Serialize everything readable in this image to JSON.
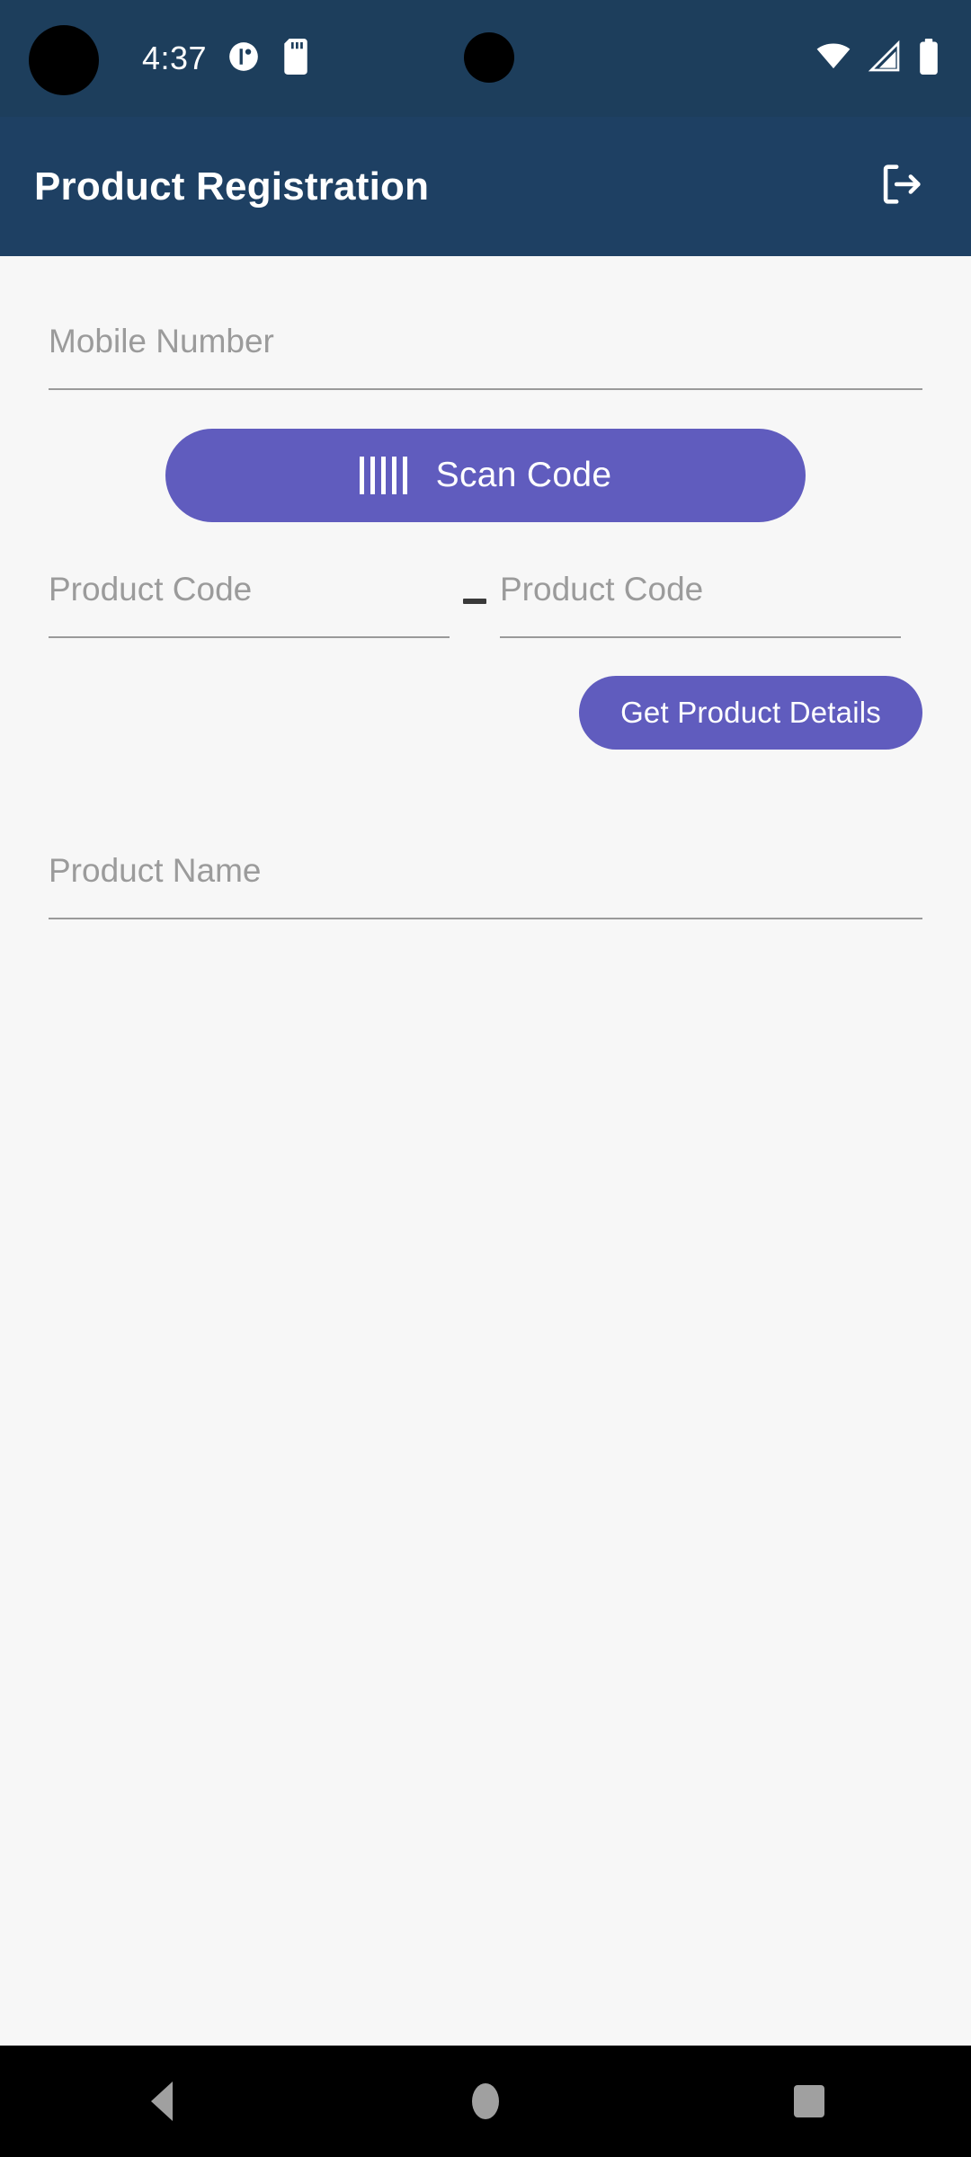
{
  "status_bar": {
    "time": "4:37",
    "background_color": "#1D3E5C",
    "notification_icons": [
      "app-circle-icon",
      "sd-card-icon"
    ],
    "system_icons": [
      "wifi-icon",
      "cellular-signal-icon",
      "battery-icon"
    ]
  },
  "app_bar": {
    "title": "Product Registration",
    "background_color": "#1E4063",
    "action_icon": "logout-icon"
  },
  "form": {
    "mobile_number": {
      "placeholder": "Mobile Number",
      "value": ""
    },
    "scan_button": {
      "label": "Scan Code",
      "icon": "barcode-icon",
      "color": "#605CBE"
    },
    "product_code_first": {
      "placeholder": "Product Code",
      "value": ""
    },
    "separator": "—",
    "product_code_second": {
      "placeholder": "Product Code",
      "value": ""
    },
    "get_details_button": {
      "label": "Get Product Details",
      "color": "#605CBE"
    },
    "product_name": {
      "placeholder": "Product Name",
      "value": ""
    }
  },
  "nav_bar": {
    "background_color": "#000000",
    "buttons": [
      {
        "name": "back",
        "icon": "back-triangle-icon"
      },
      {
        "name": "home",
        "icon": "home-circle-icon"
      },
      {
        "name": "recents",
        "icon": "recents-square-icon"
      }
    ]
  },
  "theme": {
    "content_background": "#F7F7F7",
    "accent": "#605CBE",
    "placeholder_text": "#9B9B9B",
    "underline": "#9A9A9A"
  }
}
